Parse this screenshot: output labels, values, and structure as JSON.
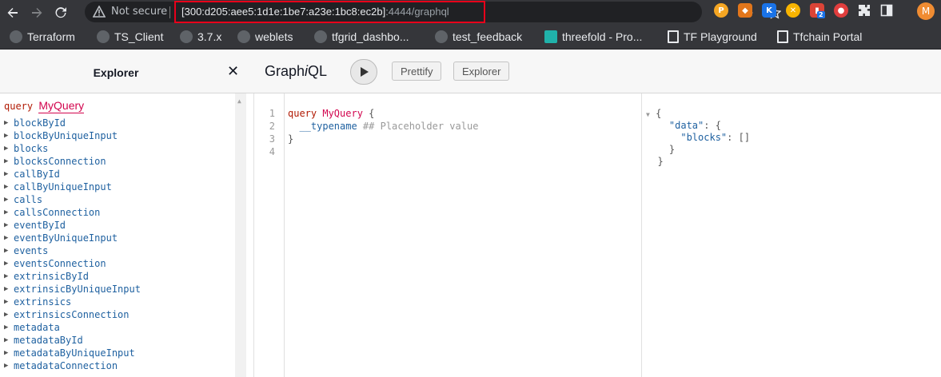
{
  "browser": {
    "security_label": "Not secure",
    "url_host": "[300:d205:aee5:1d1e:1be7:a23e:1bc8:ec2b]",
    "url_path": ":4444/graphql",
    "avatar_letter": "M",
    "extension_badge": "2",
    "bookmarks": [
      {
        "label": "Terraform"
      },
      {
        "label": "TS_Client"
      },
      {
        "label": "3.7.x"
      },
      {
        "label": "weblets"
      },
      {
        "label": "tfgrid_dashbo..."
      },
      {
        "label": "test_feedback"
      },
      {
        "label": "threefold - Pro..."
      },
      {
        "label": "TF Playground"
      },
      {
        "label": "Tfchain Portal"
      }
    ]
  },
  "explorer": {
    "title": "Explorer",
    "query_keyword": "query",
    "query_name": "MyQuery",
    "fields": [
      "blockById",
      "blockByUniqueInput",
      "blocks",
      "blocksConnection",
      "callById",
      "callByUniqueInput",
      "calls",
      "callsConnection",
      "eventById",
      "eventByUniqueInput",
      "events",
      "eventsConnection",
      "extrinsicById",
      "extrinsicByUniqueInput",
      "extrinsics",
      "extrinsicsConnection",
      "metadata",
      "metadataById",
      "metadataByUniqueInput",
      "metadataConnection"
    ]
  },
  "graphiql": {
    "title_prefix": "Graph",
    "title_italic": "i",
    "title_suffix": "QL",
    "prettify_label": "Prettify",
    "explorer_label": "Explorer"
  },
  "editor": {
    "line_numbers": [
      "1",
      "2",
      "3",
      "4"
    ],
    "kw": "query",
    "name": "MyQuery",
    "open_brace": " {",
    "field": "__typename",
    "comment": " ## Placeholder value",
    "close_brace": "}"
  },
  "result": {
    "open": "{",
    "data_key": "\"data\"",
    "data_open": ": {",
    "blocks_key": "\"blocks\"",
    "blocks_value": ": []",
    "data_close": "}",
    "close": "}"
  }
}
